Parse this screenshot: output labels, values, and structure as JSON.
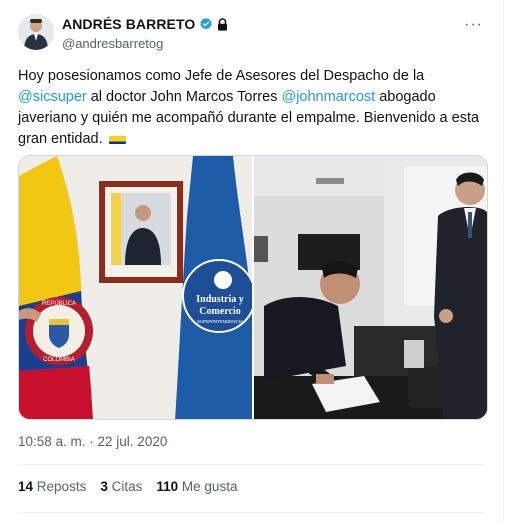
{
  "author": {
    "display_name": "ANDRÉS BARRETO",
    "handle": "@andresbarretog",
    "avatar_icon": "person-avatar",
    "verified_icon": "verified-badge-icon",
    "protected_icon": "lock-icon"
  },
  "menu_icon": "more-options-icon",
  "tweet": {
    "text_part1": "Hoy posesionamos como Jefe de Asesores del Despacho de la ",
    "mention1": "@sicsuper",
    "text_part2": " al doctor John Marcos Torres ",
    "mention2": "@johnmarcost",
    "text_part3": " abogado javeriano y quién me acompañó durante el empalme. Bienvenido a esta gran entidad. ",
    "flag_emoji": "colombia-flag-emoji"
  },
  "media": {
    "photo1": {
      "flag_seal_text_top": "REPÚBLICA",
      "flag_seal_text_bottom": "COLOMBIA",
      "sic_line1": "Industria y",
      "sic_line2": "Comercio",
      "sic_line3": "SUPERINTENDENCIA"
    }
  },
  "timestamp": "10:58 a. m. · 22 jul. 2020",
  "stats": {
    "reposts_count": "14",
    "reposts_label": "Reposts",
    "quotes_count": "3",
    "quotes_label": "Citas",
    "likes_count": "110",
    "likes_label": "Me gusta"
  },
  "colors": {
    "accent": "#1d9bf0",
    "text": "#0f1419",
    "secondary": "#536471",
    "border": "#eff3f4"
  }
}
